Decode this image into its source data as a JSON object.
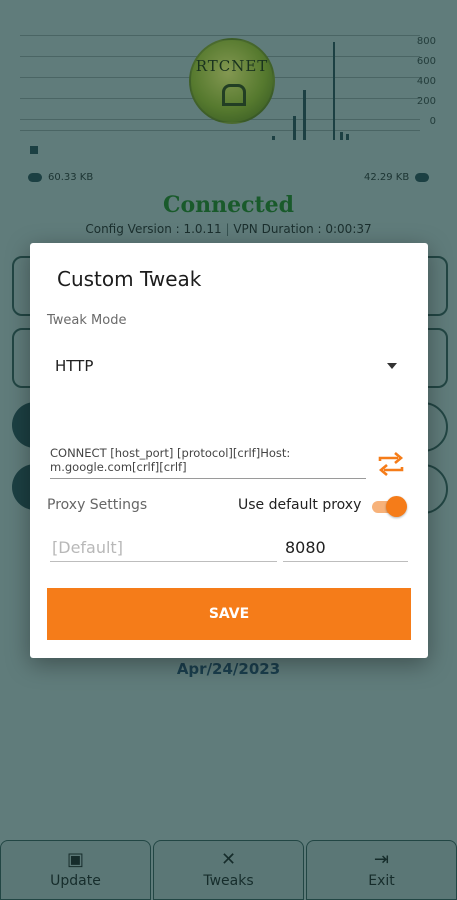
{
  "graph": {
    "y_labels": [
      "800",
      "600",
      "400",
      "200",
      "0"
    ]
  },
  "logo": {
    "text": "RTCNET"
  },
  "traffic": {
    "download": "60.33 KB",
    "upload": "42.29 KB"
  },
  "status": {
    "connected": "Connected",
    "config_version": "Config Version : 1.0.11",
    "vpn_duration": "VPN Duration : 0:00:37",
    "expiry_date": "Apr/24/2023"
  },
  "dialog": {
    "title": "Custom Tweak",
    "tweak_mode_label": "Tweak Mode",
    "tweak_mode_value": "HTTP",
    "payload": "CONNECT [host_port] [protocol][crlf]Host: m.google.com[crlf][crlf]",
    "proxy_settings_label": "Proxy Settings",
    "use_default_proxy_label": "Use default proxy",
    "use_default_proxy_on": true,
    "proxy_host_placeholder": "[Default]",
    "proxy_port_value": "8080",
    "save_label": "SAVE"
  },
  "bottom_nav": [
    {
      "label": "Update",
      "icon": "update-icon"
    },
    {
      "label": "Tweaks",
      "icon": "tools-icon"
    },
    {
      "label": "Exit",
      "icon": "exit-icon"
    }
  ],
  "colors": {
    "accent": "#f57c19",
    "connected": "#1c7a2e",
    "date": "#1f4e66"
  }
}
